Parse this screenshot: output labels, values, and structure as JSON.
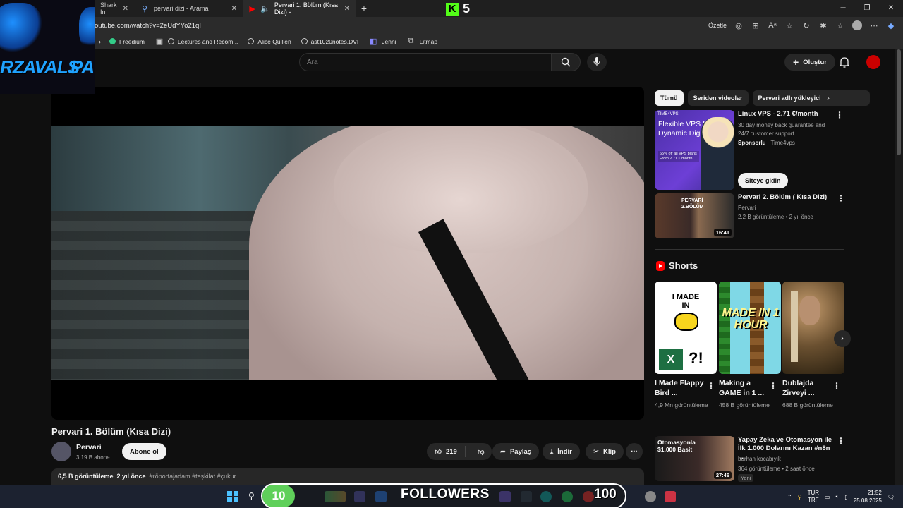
{
  "browser": {
    "tabs": [
      {
        "label": "Shark In",
        "icon": "shark-icon"
      },
      {
        "label": "pervari dizi - Arama",
        "icon": "search-icon"
      },
      {
        "label": "Pervari 1. Bölüm (Kısa Dizi) -",
        "icon": "youtube-icon",
        "active": true
      }
    ],
    "kick_count": "5",
    "url": "outube.com/watch?v=2eUdYYo21qI",
    "summarize_label": "Özetle",
    "bookmarks": [
      {
        "label": "Freedium"
      },
      {
        "label": "Lectures and Recom..."
      },
      {
        "label": "Alice Quillen"
      },
      {
        "label": "ast1020notes.DVI"
      },
      {
        "label": "Jenni"
      },
      {
        "label": "Litmap"
      }
    ]
  },
  "overlay_logo": {
    "left_text": "RZAVALS",
    "right_text": "PA"
  },
  "youtube": {
    "search_placeholder": "Ara",
    "create_label": "Oluştur",
    "video": {
      "title": "Pervari 1. Bölüm (Kısa Dizi)",
      "channel": "Pervari",
      "subscribers": "3,19 B abone",
      "subscribe_label": "Abone ol",
      "likes": "219",
      "share_label": "Paylaş",
      "download_label": "İndir",
      "clip_label": "Klip",
      "views": "6,5 B görüntüleme",
      "age": "2 yıl önce",
      "tags": "#röportajadam #teşkilat #çukur"
    },
    "chips": [
      "Tümü",
      "Seriden videolar",
      "Pervari adlı yükleyici"
    ],
    "ad": {
      "brand": "TIME4VPS",
      "headline": "Flexible VPS for a Dynamic Digital World",
      "price_tag": "65% off all VPS plans From 2.71 €/month",
      "title": "Linux VPS - 2.71 €/month",
      "description": "30 day money back guarantee and 24/7 customer support",
      "sponsored": "Sponsorlu",
      "advertiser": "Time4vps",
      "cta": "Siteye gidin"
    },
    "rec1": {
      "thumb_label": "PERVARİ 2.BÖLÜM",
      "title": "Pervari 2. Bölüm ( Kısa Dizi)",
      "channel": "Pervari",
      "meta": "2,2 B görüntüleme • 2 yıl önce",
      "duration": "16:41"
    },
    "shorts_heading": "Shorts",
    "shorts": [
      {
        "thumb": "I MADE IN",
        "title": "I Made Flappy Bird ...",
        "views": "4,9 Mn görüntüleme"
      },
      {
        "thumb": "MADE IN 1 HOUR",
        "title": "Making a GAME in 1 ...",
        "views": "458 B görüntüleme"
      },
      {
        "thumb": "",
        "title": "Dublajda Zirveyi ...",
        "views": "688 B görüntüleme"
      }
    ],
    "rec2": {
      "thumb_line1": "Otomasyonla",
      "thumb_line2": "$1,000 Basit",
      "title": "Yapay Zeka ve Otomasyon ile İlk 1.000 Dolarını Kazan #n8n ...",
      "channel": "burhan kocabıyık",
      "meta": "364 görüntüleme • 2 saat önce",
      "badge": "Yeni",
      "duration": "27:46"
    }
  },
  "taskbar": {
    "overlay_left": "10",
    "overlay_text": "FOLLOWERS",
    "overlay_right": "100",
    "lang_top": "TUR",
    "lang_bottom": "TRF",
    "time": "21:52",
    "date": "25.08.2025"
  },
  "colors": {
    "youtube_bg": "#0f0f0f",
    "kick_green": "#53fc18",
    "taskbar": "#1c2230"
  }
}
